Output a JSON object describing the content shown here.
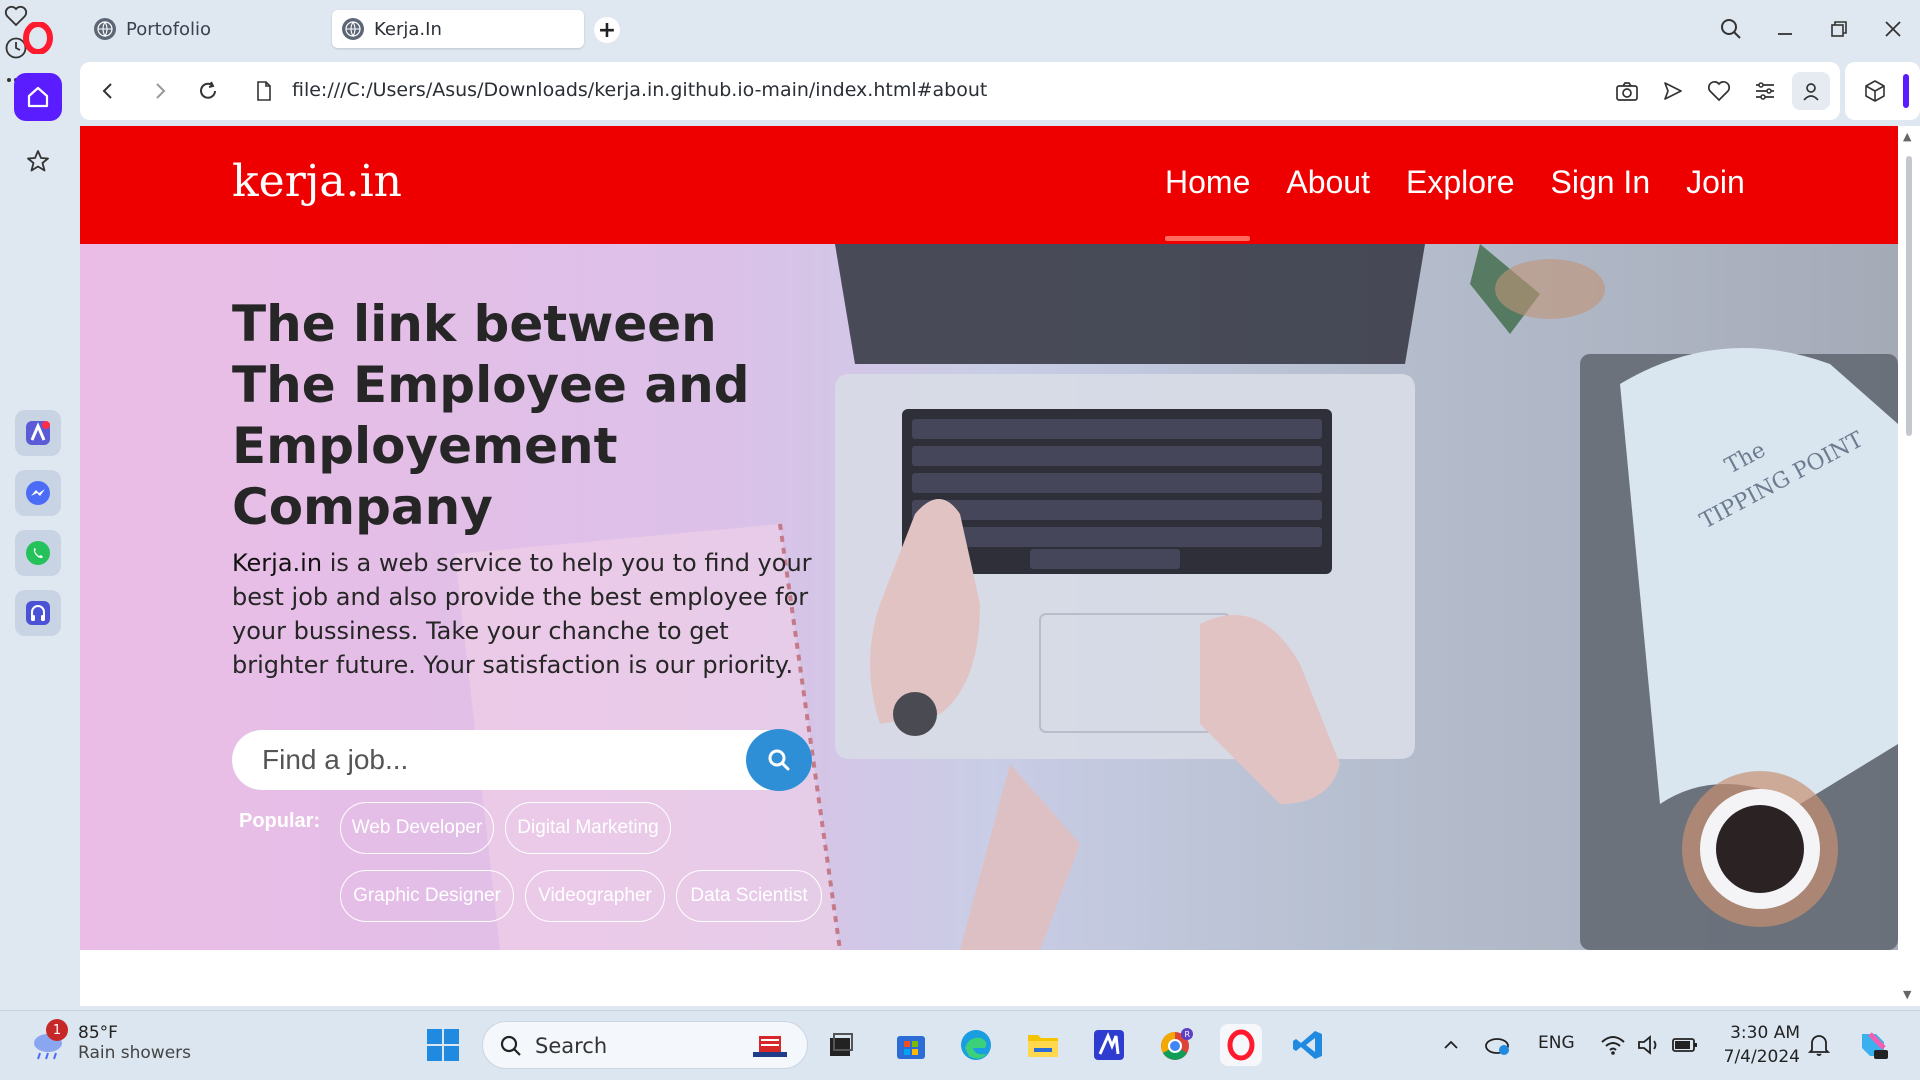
{
  "browser": {
    "tabs": [
      {
        "label": "Portofolio",
        "active": false
      },
      {
        "label": "Kerja.In",
        "active": true
      }
    ],
    "new_tab": "+",
    "url": "file:///C:/Users/Asus/Downloads/kerja.in.github.io-main/index.html#about",
    "accent_color": "#5a1dff"
  },
  "site": {
    "brand": "kerja.in",
    "nav": [
      "Home",
      "About",
      "Explore",
      "Sign In",
      "Join"
    ],
    "active_nav": "Home",
    "hero": {
      "title": "The link between The Employee and Employement Company",
      "desc_brand": "Kerja.in",
      "desc_rest": " is a web service to help you to find your best job and also provide the best employee for your bussiness. Take your chanche to get brighter future. Your satisfaction is our priority.",
      "search_placeholder": "Find a job...",
      "popular_label": "Popular:",
      "popular": [
        "Web Developer",
        "Digital Marketing",
        "Graphic Designer",
        "Videographer",
        "Data Scientist"
      ]
    },
    "colors": {
      "navbar": "#ee0000",
      "search_button": "#2f8fd6"
    }
  },
  "taskbar": {
    "weather_temp": "85°F",
    "weather_cond": "Rain showers",
    "weather_badge": "1",
    "search_label": "Search",
    "language": "ENG",
    "time": "3:30 AM",
    "date": "7/4/2024"
  }
}
